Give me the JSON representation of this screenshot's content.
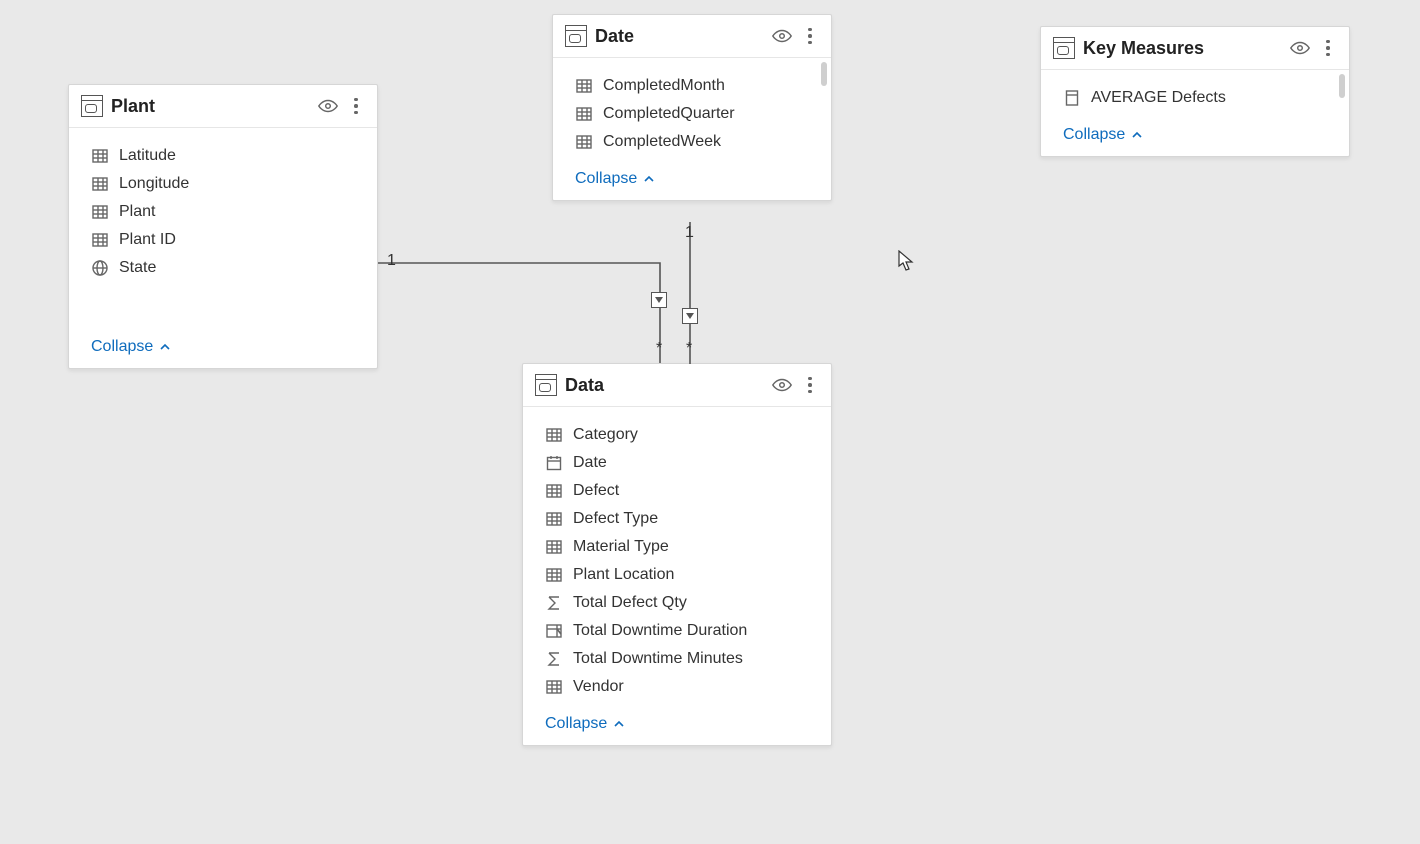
{
  "collapse_label": "Collapse",
  "tables": {
    "plant": {
      "title": "Plant",
      "fields": [
        {
          "icon": "table",
          "label": "Latitude"
        },
        {
          "icon": "table",
          "label": "Longitude"
        },
        {
          "icon": "table",
          "label": "Plant"
        },
        {
          "icon": "table",
          "label": "Plant ID"
        },
        {
          "icon": "globe",
          "label": "State"
        }
      ]
    },
    "date": {
      "title": "Date",
      "fields": [
        {
          "icon": "table",
          "label": "CompletedMonth"
        },
        {
          "icon": "table",
          "label": "CompletedQuarter"
        },
        {
          "icon": "table",
          "label": "CompletedWeek"
        }
      ]
    },
    "data": {
      "title": "Data",
      "fields": [
        {
          "icon": "table",
          "label": "Category"
        },
        {
          "icon": "calendar",
          "label": "Date"
        },
        {
          "icon": "table",
          "label": "Defect"
        },
        {
          "icon": "table",
          "label": "Defect Type"
        },
        {
          "icon": "table",
          "label": "Material Type"
        },
        {
          "icon": "table",
          "label": "Plant Location"
        },
        {
          "icon": "sigma",
          "label": "Total Defect Qty"
        },
        {
          "icon": "measure",
          "label": "Total Downtime Duration"
        },
        {
          "icon": "sigma",
          "label": "Total Downtime Minutes"
        },
        {
          "icon": "table",
          "label": "Vendor"
        }
      ]
    },
    "keymeasures": {
      "title": "Key Measures",
      "fields": [
        {
          "icon": "calc",
          "label": "AVERAGE Defects"
        }
      ]
    }
  },
  "relationships": {
    "plant_to_data": {
      "from_card": "1",
      "to_card": "*"
    },
    "date_to_data": {
      "from_card": "1",
      "to_card": "*"
    }
  }
}
